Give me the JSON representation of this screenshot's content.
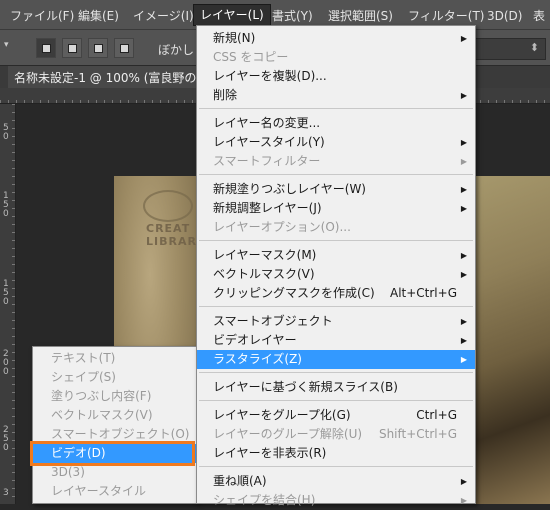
{
  "menubar": {
    "items": [
      {
        "label": "ファイル(F)"
      },
      {
        "label": "編集(E)"
      },
      {
        "label": "イメージ(I)"
      },
      {
        "label": "レイヤー(L)"
      },
      {
        "label": "書式(Y)"
      },
      {
        "label": "選択範囲(S)"
      },
      {
        "label": "フィルター(T)"
      },
      {
        "label": "3D(D)"
      },
      {
        "label": "表"
      }
    ]
  },
  "options_bar": {
    "blur_label": "ぼかし :"
  },
  "document": {
    "title": "名称未設定-1 @ 100% (富良野の"
  },
  "ruler": {
    "v_numbers": [
      "5",
      "0",
      "1",
      "5",
      "0",
      "1",
      "5",
      "0",
      "2",
      "0",
      "0",
      "2",
      "5",
      "0",
      "3"
    ]
  },
  "watermark": {
    "line1": "CREAT",
    "line2": "LIBRAR"
  },
  "layer_menu": {
    "items": [
      {
        "label": "新規(N)",
        "shortcut": "",
        "submenu": true,
        "disabled": false
      },
      {
        "label": "CSS をコピー",
        "shortcut": "",
        "submenu": false,
        "disabled": true
      },
      {
        "label": "レイヤーを複製(D)...",
        "shortcut": "",
        "submenu": false,
        "disabled": false
      },
      {
        "label": "削除",
        "shortcut": "",
        "submenu": true,
        "disabled": false
      },
      {
        "label": "レイヤー名の変更...",
        "shortcut": "",
        "submenu": false,
        "disabled": false
      },
      {
        "label": "レイヤースタイル(Y)",
        "shortcut": "",
        "submenu": true,
        "disabled": false
      },
      {
        "label": "スマートフィルター",
        "shortcut": "",
        "submenu": true,
        "disabled": true
      },
      {
        "label": "新規塗りつぶしレイヤー(W)",
        "shortcut": "",
        "submenu": true,
        "disabled": false
      },
      {
        "label": "新規調整レイヤー(J)",
        "shortcut": "",
        "submenu": true,
        "disabled": false
      },
      {
        "label": "レイヤーオプション(O)...",
        "shortcut": "",
        "submenu": false,
        "disabled": true
      },
      {
        "label": "レイヤーマスク(M)",
        "shortcut": "",
        "submenu": true,
        "disabled": false
      },
      {
        "label": "ベクトルマスク(V)",
        "shortcut": "",
        "submenu": true,
        "disabled": false
      },
      {
        "label": "クリッピングマスクを作成(C)",
        "shortcut": "Alt+Ctrl+G",
        "submenu": false,
        "disabled": false
      },
      {
        "label": "スマートオブジェクト",
        "shortcut": "",
        "submenu": true,
        "disabled": false
      },
      {
        "label": "ビデオレイヤー",
        "shortcut": "",
        "submenu": true,
        "disabled": false
      },
      {
        "label": "ラスタライズ(Z)",
        "shortcut": "",
        "submenu": true,
        "disabled": false,
        "highlighted": true
      },
      {
        "label": "レイヤーに基づく新規スライス(B)",
        "shortcut": "",
        "submenu": false,
        "disabled": false
      },
      {
        "label": "レイヤーをグループ化(G)",
        "shortcut": "Ctrl+G",
        "submenu": false,
        "disabled": false
      },
      {
        "label": "レイヤーのグループ解除(U)",
        "shortcut": "Shift+Ctrl+G",
        "submenu": false,
        "disabled": true
      },
      {
        "label": "レイヤーを非表示(R)",
        "shortcut": "",
        "submenu": false,
        "disabled": false
      },
      {
        "label": "重ね順(A)",
        "shortcut": "",
        "submenu": true,
        "disabled": false
      },
      {
        "label": "シェイプを結合(H)",
        "shortcut": "",
        "submenu": true,
        "disabled": true
      }
    ]
  },
  "rasterize_submenu": {
    "items": [
      {
        "label": "テキスト(T)",
        "disabled": true
      },
      {
        "label": "シェイプ(S)",
        "disabled": true
      },
      {
        "label": "塗りつぶし内容(F)",
        "disabled": true
      },
      {
        "label": "ベクトルマスク(V)",
        "disabled": true
      },
      {
        "label": "スマートオブジェクト(O)",
        "disabled": true
      },
      {
        "label": "ビデオ(D)",
        "disabled": false,
        "highlighted": true
      },
      {
        "label": "3D(3)",
        "disabled": true
      },
      {
        "label": "レイヤースタイル",
        "disabled": true
      }
    ]
  },
  "colors": {
    "highlight": "#3399ff",
    "callout": "#f07a1e",
    "menu_bg": "#f0f0f0",
    "chrome": "#535353"
  }
}
